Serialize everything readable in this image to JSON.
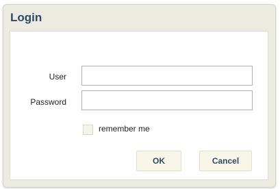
{
  "dialog": {
    "title": "Login",
    "user_label": "User",
    "password_label": "Password",
    "user_value": "",
    "password_value": "",
    "remember_label": "remember me",
    "remember_checked": false,
    "ok_label": "OK",
    "cancel_label": "Cancel"
  },
  "colors": {
    "title": "#2f4a64",
    "dialog_background": "#ebebe1",
    "button_background": "#f7f6e8"
  }
}
